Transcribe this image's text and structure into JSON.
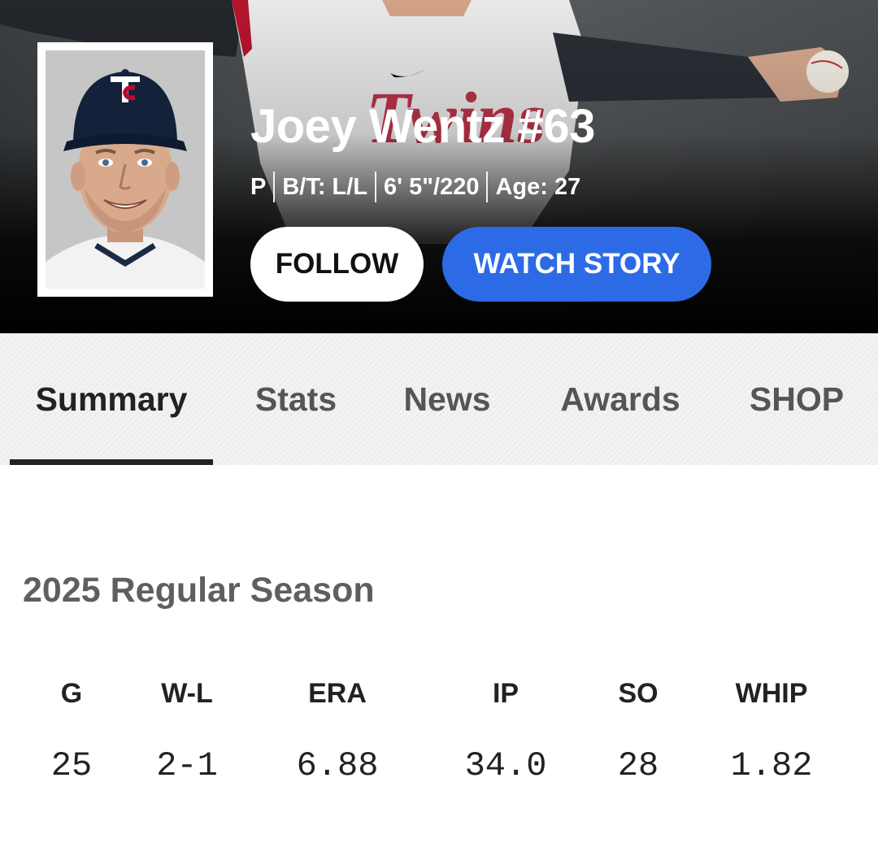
{
  "player": {
    "name": "Joey Wentz #63",
    "position": "P",
    "bats_throws": "B/T: L/L",
    "height_weight": "6' 5\"/220",
    "age": "Age: 27"
  },
  "actions": {
    "follow_label": "FOLLOW",
    "watch_label": "WATCH STORY"
  },
  "tabs": [
    {
      "label": "Summary",
      "active": true
    },
    {
      "label": "Stats",
      "active": false
    },
    {
      "label": "News",
      "active": false
    },
    {
      "label": "Awards",
      "active": false
    },
    {
      "label": "SHOP",
      "active": false
    }
  ],
  "season": {
    "title": "2025 Regular Season",
    "columns": [
      {
        "header": "G",
        "value": "25"
      },
      {
        "header": "W-L",
        "value": "2-1"
      },
      {
        "header": "ERA",
        "value": "6.88"
      },
      {
        "header": "IP",
        "value": "34.0"
      },
      {
        "header": "SO",
        "value": "28"
      },
      {
        "header": "WHIP",
        "value": "1.82"
      }
    ]
  },
  "colors": {
    "watch_button": "#2d6be6",
    "twins_navy": "#0c2340",
    "twins_red": "#ba0c2f"
  },
  "icons": {
    "cap_logo": "twins-tc-logo"
  }
}
